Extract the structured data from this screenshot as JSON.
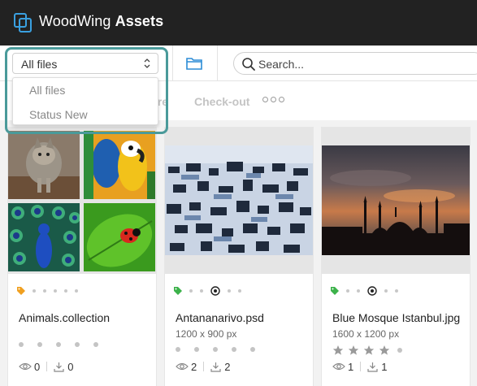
{
  "header": {
    "brand_regular": "WoodWing ",
    "brand_bold": "Assets"
  },
  "filter": {
    "selected": "All files",
    "options": [
      "All files",
      "Status New"
    ]
  },
  "search": {
    "placeholder": "Search..."
  },
  "actions": {
    "share_partial": "are",
    "checkout": "Check-out"
  },
  "colors": {
    "accent_frame": "#4a9a9a",
    "tag_orange": "#f0a020",
    "tag_green": "#3cb24a"
  },
  "cards": [
    {
      "name": "Animals.collection",
      "dims": "",
      "tag_icon": "tag-icon",
      "tag_color": "#f0a020",
      "views": "0",
      "downloads": "0",
      "rating": 0,
      "icons": [
        "cat-photo",
        "parrot-photo",
        "peacock-photo",
        "ladybug-photo"
      ]
    },
    {
      "name": "Antananarivo.psd",
      "dims": "1200 x 900 px",
      "tag_icon": "tag-icon",
      "tag_color": "#3cb24a",
      "views": "2",
      "downloads": "2",
      "rating": 0
    },
    {
      "name": "Blue Mosque Istanbul.jpg",
      "dims": "1600 x 1200 px",
      "tag_icon": "tag-icon",
      "tag_color": "#3cb24a",
      "views": "1",
      "downloads": "1",
      "rating": 4
    }
  ]
}
